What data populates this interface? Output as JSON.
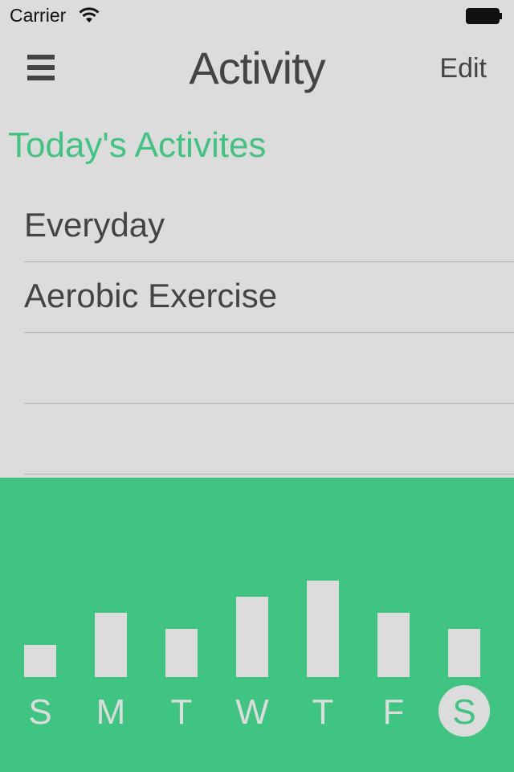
{
  "status_bar": {
    "carrier": "Carrier",
    "wifi_icon": "wifi-icon",
    "battery_icon": "battery-icon"
  },
  "nav": {
    "menu_icon": "hamburger-menu-icon",
    "title": "Activity",
    "edit_label": "Edit"
  },
  "section": {
    "heading": "Today's Activites"
  },
  "activities": [
    {
      "label": "Everyday"
    },
    {
      "label": "Aerobic Exercise"
    },
    {
      "label": ""
    },
    {
      "label": ""
    }
  ],
  "colors": {
    "accent": "#3fc481",
    "background": "#dcdcdc",
    "text": "#444444",
    "bar": "#dcdcdc",
    "selected_day": "#dcdcdc"
  },
  "chart_data": {
    "type": "bar",
    "categories": [
      "S",
      "M",
      "T",
      "W",
      "T",
      "F",
      "S"
    ],
    "values": [
      2,
      4,
      3,
      5,
      6,
      4,
      3
    ],
    "ylim": [
      0,
      6
    ],
    "selected_index": 6,
    "grid": false
  }
}
